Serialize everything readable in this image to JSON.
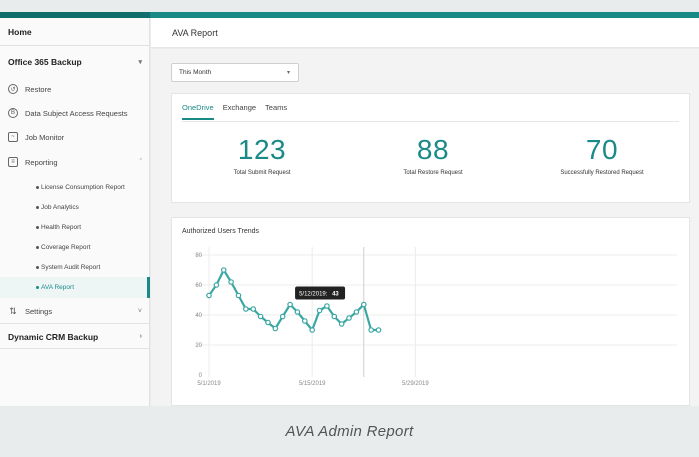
{
  "sidebar": {
    "home": "Home",
    "office_backup": "Office 365 Backup",
    "restore": "Restore",
    "dsar": "Data Subject Access Requests",
    "job_monitor": "Job Monitor",
    "reporting": "Reporting",
    "reports": [
      "License Consumption Report",
      "Job Analytics",
      "Health Report",
      "Coverage Report",
      "System Audit Report",
      "AVA Report"
    ],
    "settings": "Settings",
    "crm_backup": "Dynamic CRM Backup"
  },
  "header": {
    "title": "AVA Report"
  },
  "filter": {
    "period": "This Month"
  },
  "tabs": [
    "OneDrive",
    "Exchange",
    "Teams"
  ],
  "stats": [
    {
      "value": "123",
      "label": "Total Submit Request"
    },
    {
      "value": "88",
      "label": "Total Restore Request"
    },
    {
      "value": "70",
      "label": "Successfully Restored Request"
    }
  ],
  "chart_data": {
    "type": "line",
    "title": "Authorized Users Trends",
    "x": [
      "5/1/2019",
      "5/2/2019",
      "5/3/2019",
      "5/4/2019",
      "5/5/2019",
      "5/6/2019",
      "5/7/2019",
      "5/8/2019",
      "5/9/2019",
      "5/10/2019",
      "5/11/2019",
      "5/12/2019",
      "5/13/2019",
      "5/14/2019",
      "5/15/2019",
      "5/16/2019",
      "5/17/2019",
      "5/18/2019",
      "5/19/2019",
      "5/20/2019",
      "5/21/2019",
      "5/22/2019",
      "5/23/2019",
      "5/24/2019"
    ],
    "values": [
      53,
      60,
      70,
      62,
      53,
      44,
      44,
      39,
      35,
      31,
      39,
      47,
      42,
      36,
      30,
      43,
      46,
      39,
      34,
      38,
      42,
      47,
      30,
      30
    ],
    "xticks": [
      "5/1/2019",
      "5/15/2019",
      "5/29/2019"
    ],
    "yticks": [
      0,
      20,
      40,
      60,
      80
    ],
    "ylim": [
      0,
      80
    ],
    "grid": true,
    "color": "#3aa7a3",
    "tooltip": {
      "date": "5/12/2019:",
      "value": "43"
    }
  },
  "caption": "AVA Admin Report"
}
